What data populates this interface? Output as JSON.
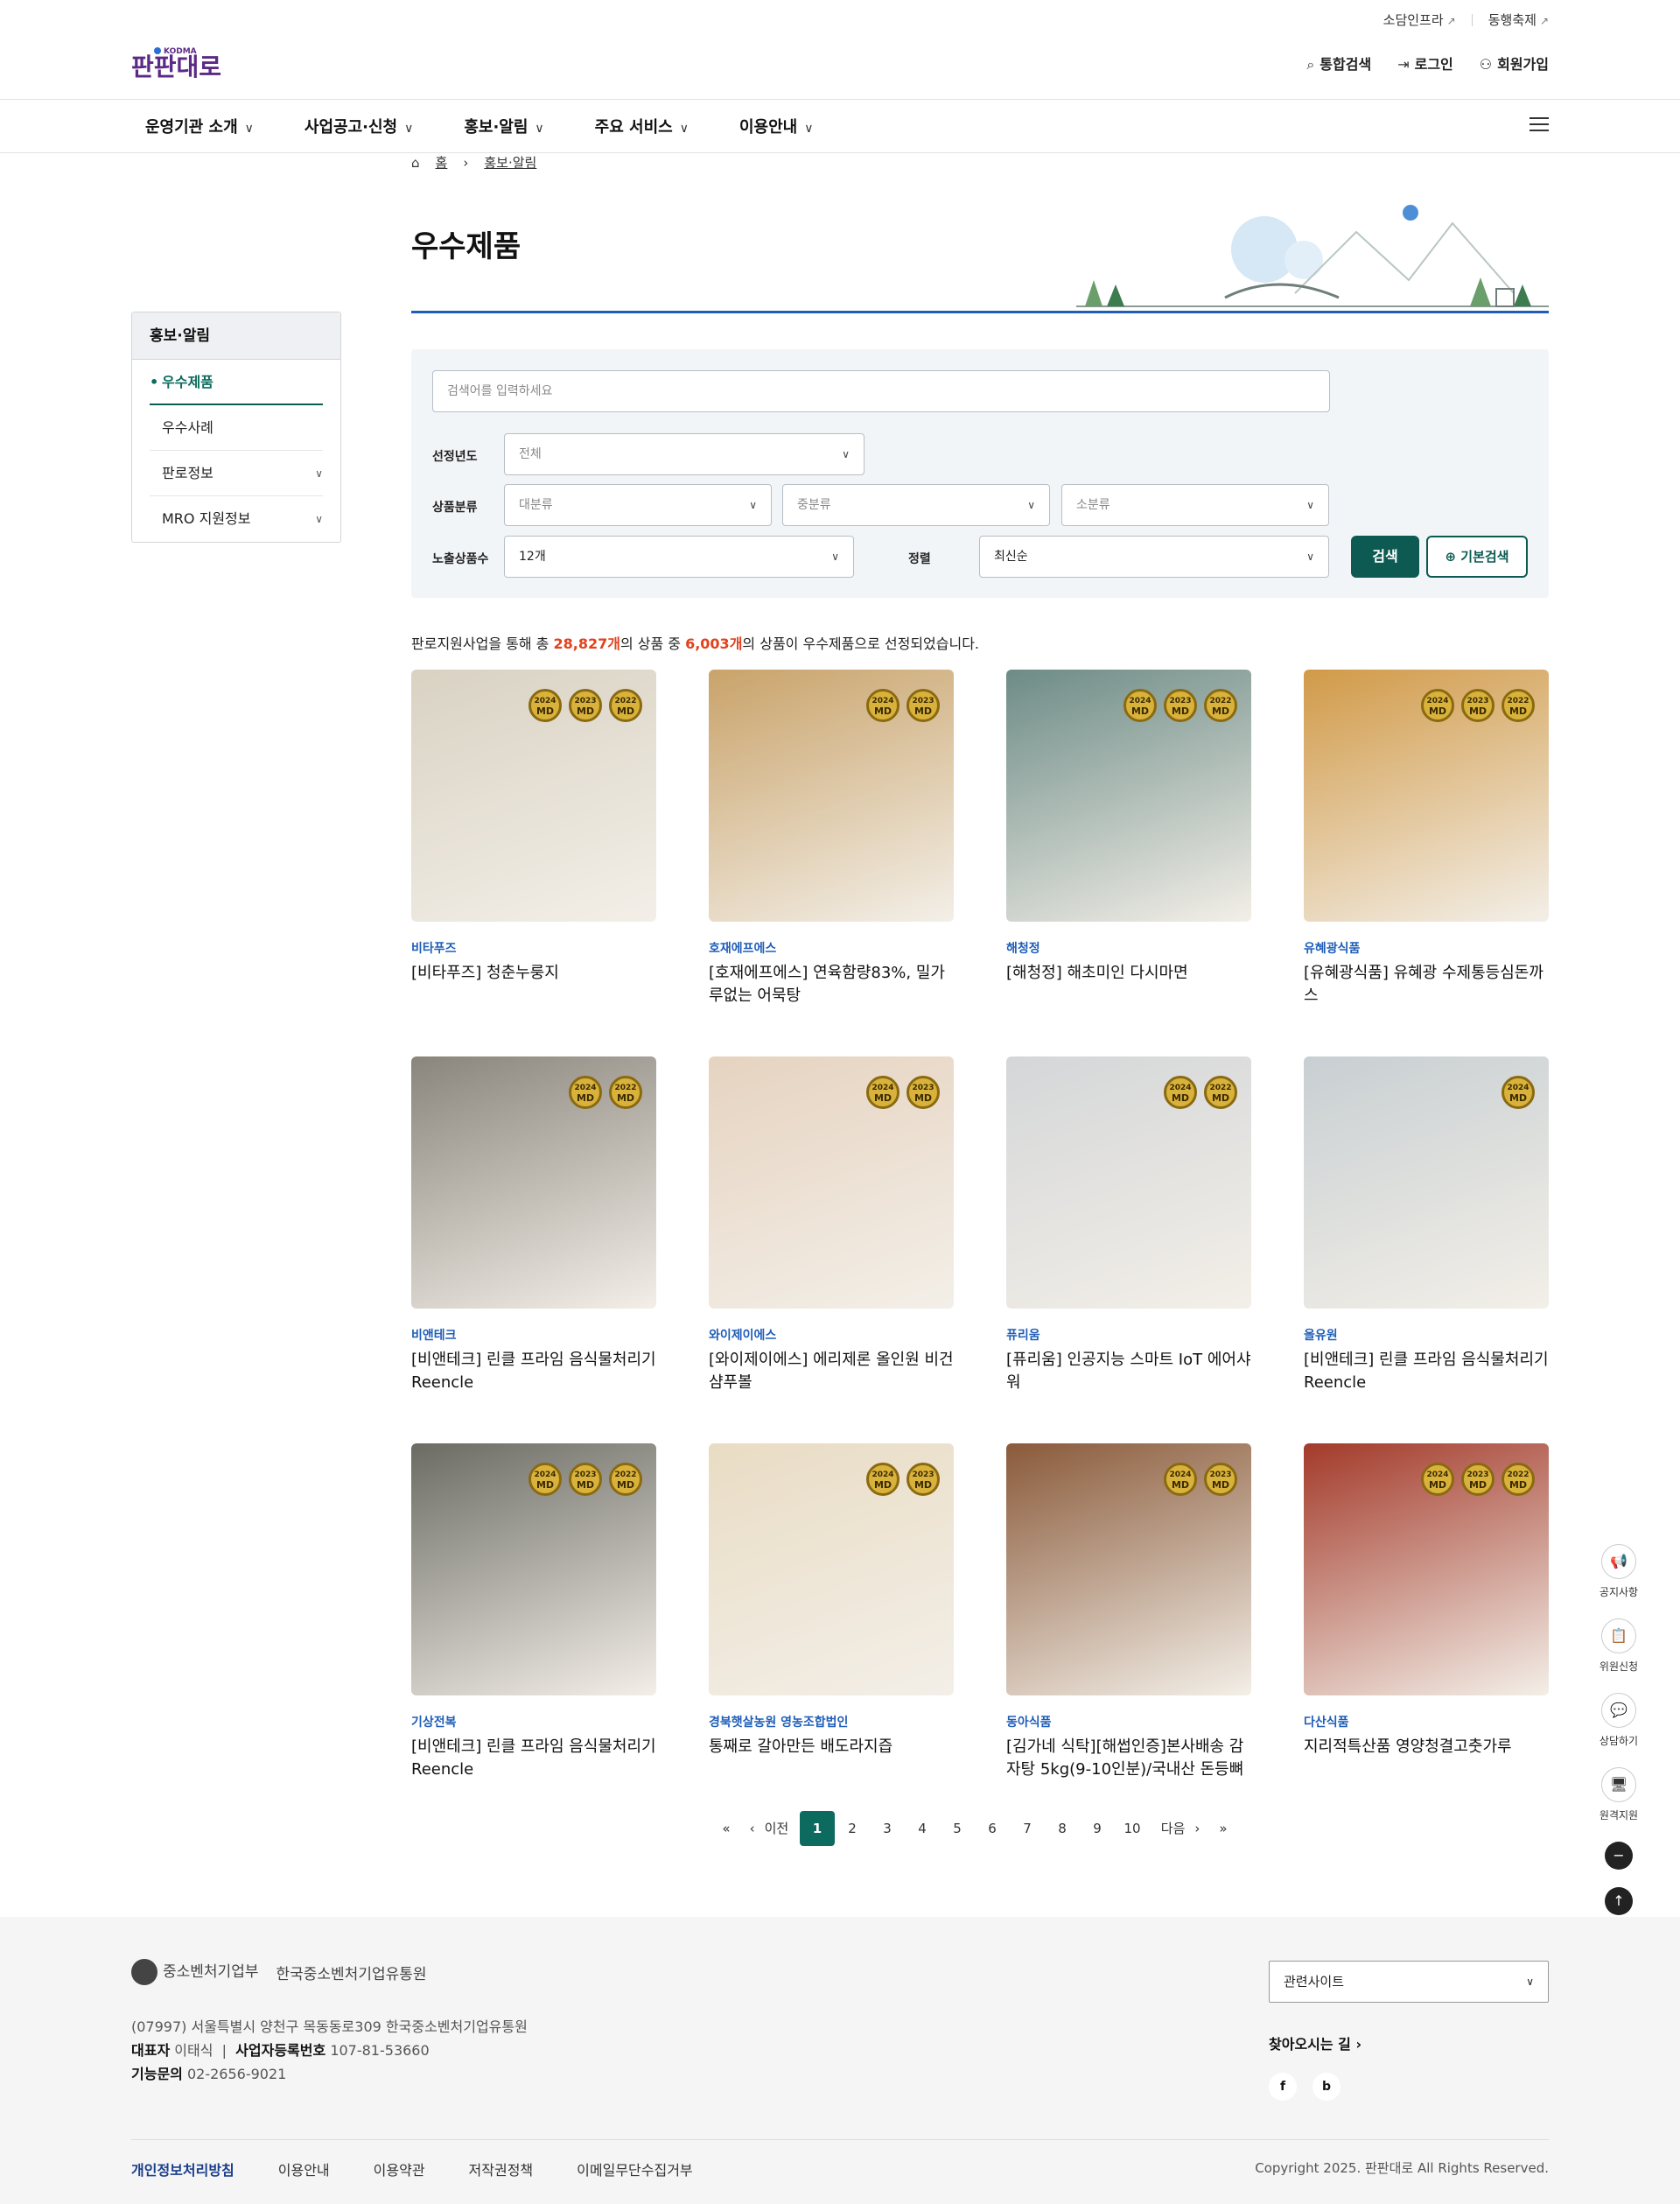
{
  "header": {
    "logo_alt": "판판대로 KODMA",
    "util_links": [
      "소담인프라",
      "동행축제"
    ],
    "auth": {
      "search": "통합검색",
      "login": "로그인",
      "signup": "회원가입"
    }
  },
  "gnb": [
    "운영기관 소개",
    "사업공고·신청",
    "홍보·알림",
    "주요 서비스",
    "이용안내"
  ],
  "side": {
    "title": "홍보·알림",
    "items": [
      "우수제품",
      "우수사례",
      "판로정보",
      "MRO 지원정보"
    ]
  },
  "breadcrumb": {
    "home": "홈",
    "current": "홍보·알림"
  },
  "page_title": "우수제품",
  "search": {
    "placeholder": "검색어를 입력하세요",
    "year_label": "선정년도",
    "year_value": "전체",
    "cat_label": "상품분류",
    "cat1": "대분류",
    "cat2": "중분류",
    "cat3": "소분류",
    "count_label": "노출상품수",
    "count_value": "12개",
    "sort_label": "정렬",
    "sort_value": "최신순",
    "search_btn": "검색",
    "basic_btn": "기본검색"
  },
  "summary": {
    "pre": "판로지원사업을 통해 총 ",
    "total": "28,827개",
    "mid": "의 상품 중 ",
    "selected": "6,003개",
    "post": "의 상품이 우수제품으로 선정되었습니다."
  },
  "products": [
    {
      "brand": "비타푸즈",
      "name": "[비타푸즈] 청춘누룽지",
      "badges": [
        "2024",
        "2023",
        "2022"
      ],
      "color": "#d9d2c3"
    },
    {
      "brand": "호재에프에스",
      "name": "[호재에프에스] 연육함량83%, 밀가루없는 어묵탕",
      "badges": [
        "2024",
        "2023"
      ],
      "color": "#c9a36a"
    },
    {
      "brand": "해청정",
      "name": "[해청정] 해초미인 다시마면",
      "badges": [
        "2024",
        "2023",
        "2022"
      ],
      "color": "#6d8b86"
    },
    {
      "brand": "유혜광식품",
      "name": "[유혜광식품] 유혜광 수제통등심돈까스",
      "badges": [
        "2024",
        "2023",
        "2022"
      ],
      "color": "#d19a48"
    },
    {
      "brand": "비앤테크",
      "name": "[비앤테크] 린클 프라임 음식물처리기 Reencle",
      "badges": [
        "2024",
        "2022"
      ],
      "color": "#8a857c"
    },
    {
      "brand": "와이제이에스",
      "name": "[와이제이에스] 에리제론 올인원 비건 샴푸볼",
      "badges": [
        "2024",
        "2023"
      ],
      "color": "#e6d3c0"
    },
    {
      "brand": "퓨리움",
      "name": "[퓨리움] 인공지능 스마트 IoT 에어샤워",
      "badges": [
        "2024",
        "2022"
      ],
      "color": "#d4d6d8"
    },
    {
      "brand": "올유원",
      "name": "[비앤테크] 린클 프라임 음식물처리기 Reencle",
      "badges": [
        "2024"
      ],
      "color": "#c8cfd2"
    },
    {
      "brand": "기상전복",
      "name": "[비앤테크] 린클 프라임 음식물처리기 Reencle",
      "badges": [
        "2024",
        "2023",
        "2022"
      ],
      "color": "#6b6b64"
    },
    {
      "brand": "경북햇살농원 영농조합법인",
      "name": "통째로 갈아만든 배도라지즙",
      "badges": [
        "2024",
        "2023"
      ],
      "color": "#e9dcc4"
    },
    {
      "brand": "동아식품",
      "name": "[김가네 식탁][해썹인증]본사배송 감자탕 5kg(9-10인분)/국내산 돈등뼈",
      "badges": [
        "2024",
        "2023"
      ],
      "color": "#8a5a3a"
    },
    {
      "brand": "다산식품",
      "name": "지리적특산품 영양청결고춧가루",
      "badges": [
        "2024",
        "2023",
        "2022"
      ],
      "color": "#a33a2a"
    }
  ],
  "pager": {
    "prev": "이전",
    "next": "다음",
    "pages": [
      "1",
      "2",
      "3",
      "4",
      "5",
      "6",
      "7",
      "8",
      "9",
      "10"
    ],
    "current": "1"
  },
  "quick": [
    "공지사항",
    "위원신청",
    "상담하기",
    "원격지원"
  ],
  "footer": {
    "logo1": "중소벤처기업부",
    "logo2": "한국중소벤처기업유통원",
    "address": "(07997) 서울특별시 양천구 목동동로309 한국중소벤처기업유통원",
    "ceo_label": "대표자",
    "ceo": "이태식",
    "biz_label": "사업자등록번호",
    "biz": "107-81-53660",
    "tel_label": "기능문의",
    "tel": "02-2656-9021",
    "related": "관련사이트",
    "directions": "찾아오시는 길",
    "links": [
      "개인정보처리방침",
      "이용안내",
      "이용약관",
      "저작권정책",
      "이메일무단수집거부"
    ],
    "copyright": "Copyright 2025. 판판대로 All Rights Reserved."
  }
}
